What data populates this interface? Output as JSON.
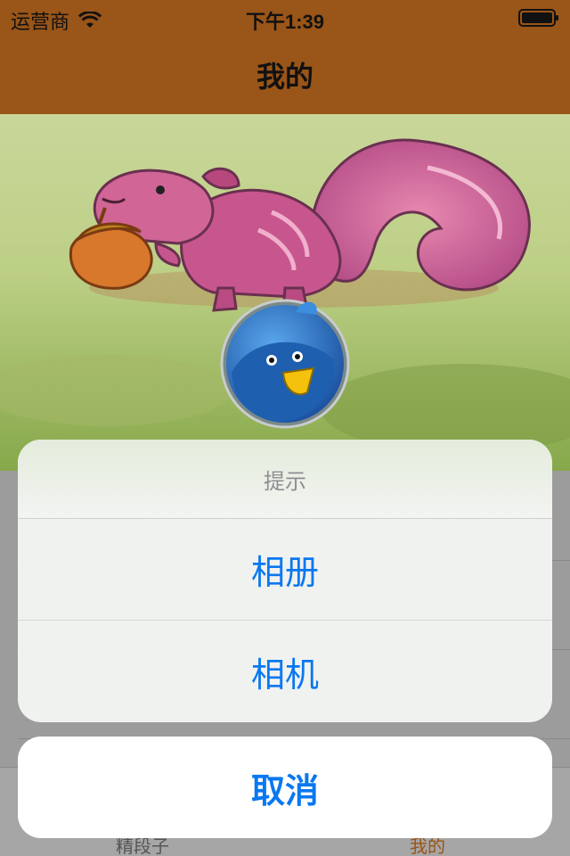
{
  "status_bar": {
    "carrier": "运营商",
    "time": "下午1:39",
    "icons": [
      "wifi-icon",
      "battery-icon"
    ]
  },
  "nav": {
    "title": "我的"
  },
  "header": {
    "image": "squirrel-illustration",
    "avatar": "bird-avatar"
  },
  "action_sheet": {
    "title": "提示",
    "options": [
      "相册",
      "相机"
    ],
    "cancel": "取消"
  },
  "tabs": [
    {
      "label": "精段子",
      "active": false
    },
    {
      "label": "我的",
      "active": true
    }
  ],
  "colors": {
    "nav_bg": "#9a5518",
    "action_blue": "#0a78f0",
    "sheet_title": "#8e8e93"
  }
}
